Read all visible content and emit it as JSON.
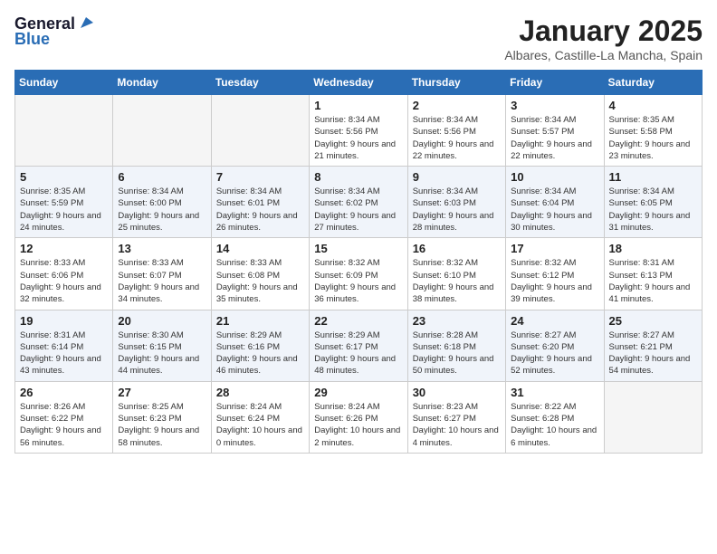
{
  "header": {
    "logo_line1": "General",
    "logo_line2": "Blue",
    "title": "January 2025",
    "subtitle": "Albares, Castille-La Mancha, Spain"
  },
  "weekdays": [
    "Sunday",
    "Monday",
    "Tuesday",
    "Wednesday",
    "Thursday",
    "Friday",
    "Saturday"
  ],
  "weeks": [
    [
      {
        "day": "",
        "sunrise": "",
        "sunset": "",
        "daylight": ""
      },
      {
        "day": "",
        "sunrise": "",
        "sunset": "",
        "daylight": ""
      },
      {
        "day": "",
        "sunrise": "",
        "sunset": "",
        "daylight": ""
      },
      {
        "day": "1",
        "sunrise": "Sunrise: 8:34 AM",
        "sunset": "Sunset: 5:56 PM",
        "daylight": "Daylight: 9 hours and 21 minutes."
      },
      {
        "day": "2",
        "sunrise": "Sunrise: 8:34 AM",
        "sunset": "Sunset: 5:56 PM",
        "daylight": "Daylight: 9 hours and 22 minutes."
      },
      {
        "day": "3",
        "sunrise": "Sunrise: 8:34 AM",
        "sunset": "Sunset: 5:57 PM",
        "daylight": "Daylight: 9 hours and 22 minutes."
      },
      {
        "day": "4",
        "sunrise": "Sunrise: 8:35 AM",
        "sunset": "Sunset: 5:58 PM",
        "daylight": "Daylight: 9 hours and 23 minutes."
      }
    ],
    [
      {
        "day": "5",
        "sunrise": "Sunrise: 8:35 AM",
        "sunset": "Sunset: 5:59 PM",
        "daylight": "Daylight: 9 hours and 24 minutes."
      },
      {
        "day": "6",
        "sunrise": "Sunrise: 8:34 AM",
        "sunset": "Sunset: 6:00 PM",
        "daylight": "Daylight: 9 hours and 25 minutes."
      },
      {
        "day": "7",
        "sunrise": "Sunrise: 8:34 AM",
        "sunset": "Sunset: 6:01 PM",
        "daylight": "Daylight: 9 hours and 26 minutes."
      },
      {
        "day": "8",
        "sunrise": "Sunrise: 8:34 AM",
        "sunset": "Sunset: 6:02 PM",
        "daylight": "Daylight: 9 hours and 27 minutes."
      },
      {
        "day": "9",
        "sunrise": "Sunrise: 8:34 AM",
        "sunset": "Sunset: 6:03 PM",
        "daylight": "Daylight: 9 hours and 28 minutes."
      },
      {
        "day": "10",
        "sunrise": "Sunrise: 8:34 AM",
        "sunset": "Sunset: 6:04 PM",
        "daylight": "Daylight: 9 hours and 30 minutes."
      },
      {
        "day": "11",
        "sunrise": "Sunrise: 8:34 AM",
        "sunset": "Sunset: 6:05 PM",
        "daylight": "Daylight: 9 hours and 31 minutes."
      }
    ],
    [
      {
        "day": "12",
        "sunrise": "Sunrise: 8:33 AM",
        "sunset": "Sunset: 6:06 PM",
        "daylight": "Daylight: 9 hours and 32 minutes."
      },
      {
        "day": "13",
        "sunrise": "Sunrise: 8:33 AM",
        "sunset": "Sunset: 6:07 PM",
        "daylight": "Daylight: 9 hours and 34 minutes."
      },
      {
        "day": "14",
        "sunrise": "Sunrise: 8:33 AM",
        "sunset": "Sunset: 6:08 PM",
        "daylight": "Daylight: 9 hours and 35 minutes."
      },
      {
        "day": "15",
        "sunrise": "Sunrise: 8:32 AM",
        "sunset": "Sunset: 6:09 PM",
        "daylight": "Daylight: 9 hours and 36 minutes."
      },
      {
        "day": "16",
        "sunrise": "Sunrise: 8:32 AM",
        "sunset": "Sunset: 6:10 PM",
        "daylight": "Daylight: 9 hours and 38 minutes."
      },
      {
        "day": "17",
        "sunrise": "Sunrise: 8:32 AM",
        "sunset": "Sunset: 6:12 PM",
        "daylight": "Daylight: 9 hours and 39 minutes."
      },
      {
        "day": "18",
        "sunrise": "Sunrise: 8:31 AM",
        "sunset": "Sunset: 6:13 PM",
        "daylight": "Daylight: 9 hours and 41 minutes."
      }
    ],
    [
      {
        "day": "19",
        "sunrise": "Sunrise: 8:31 AM",
        "sunset": "Sunset: 6:14 PM",
        "daylight": "Daylight: 9 hours and 43 minutes."
      },
      {
        "day": "20",
        "sunrise": "Sunrise: 8:30 AM",
        "sunset": "Sunset: 6:15 PM",
        "daylight": "Daylight: 9 hours and 44 minutes."
      },
      {
        "day": "21",
        "sunrise": "Sunrise: 8:29 AM",
        "sunset": "Sunset: 6:16 PM",
        "daylight": "Daylight: 9 hours and 46 minutes."
      },
      {
        "day": "22",
        "sunrise": "Sunrise: 8:29 AM",
        "sunset": "Sunset: 6:17 PM",
        "daylight": "Daylight: 9 hours and 48 minutes."
      },
      {
        "day": "23",
        "sunrise": "Sunrise: 8:28 AM",
        "sunset": "Sunset: 6:18 PM",
        "daylight": "Daylight: 9 hours and 50 minutes."
      },
      {
        "day": "24",
        "sunrise": "Sunrise: 8:27 AM",
        "sunset": "Sunset: 6:20 PM",
        "daylight": "Daylight: 9 hours and 52 minutes."
      },
      {
        "day": "25",
        "sunrise": "Sunrise: 8:27 AM",
        "sunset": "Sunset: 6:21 PM",
        "daylight": "Daylight: 9 hours and 54 minutes."
      }
    ],
    [
      {
        "day": "26",
        "sunrise": "Sunrise: 8:26 AM",
        "sunset": "Sunset: 6:22 PM",
        "daylight": "Daylight: 9 hours and 56 minutes."
      },
      {
        "day": "27",
        "sunrise": "Sunrise: 8:25 AM",
        "sunset": "Sunset: 6:23 PM",
        "daylight": "Daylight: 9 hours and 58 minutes."
      },
      {
        "day": "28",
        "sunrise": "Sunrise: 8:24 AM",
        "sunset": "Sunset: 6:24 PM",
        "daylight": "Daylight: 10 hours and 0 minutes."
      },
      {
        "day": "29",
        "sunrise": "Sunrise: 8:24 AM",
        "sunset": "Sunset: 6:26 PM",
        "daylight": "Daylight: 10 hours and 2 minutes."
      },
      {
        "day": "30",
        "sunrise": "Sunrise: 8:23 AM",
        "sunset": "Sunset: 6:27 PM",
        "daylight": "Daylight: 10 hours and 4 minutes."
      },
      {
        "day": "31",
        "sunrise": "Sunrise: 8:22 AM",
        "sunset": "Sunset: 6:28 PM",
        "daylight": "Daylight: 10 hours and 6 minutes."
      },
      {
        "day": "",
        "sunrise": "",
        "sunset": "",
        "daylight": ""
      }
    ]
  ]
}
